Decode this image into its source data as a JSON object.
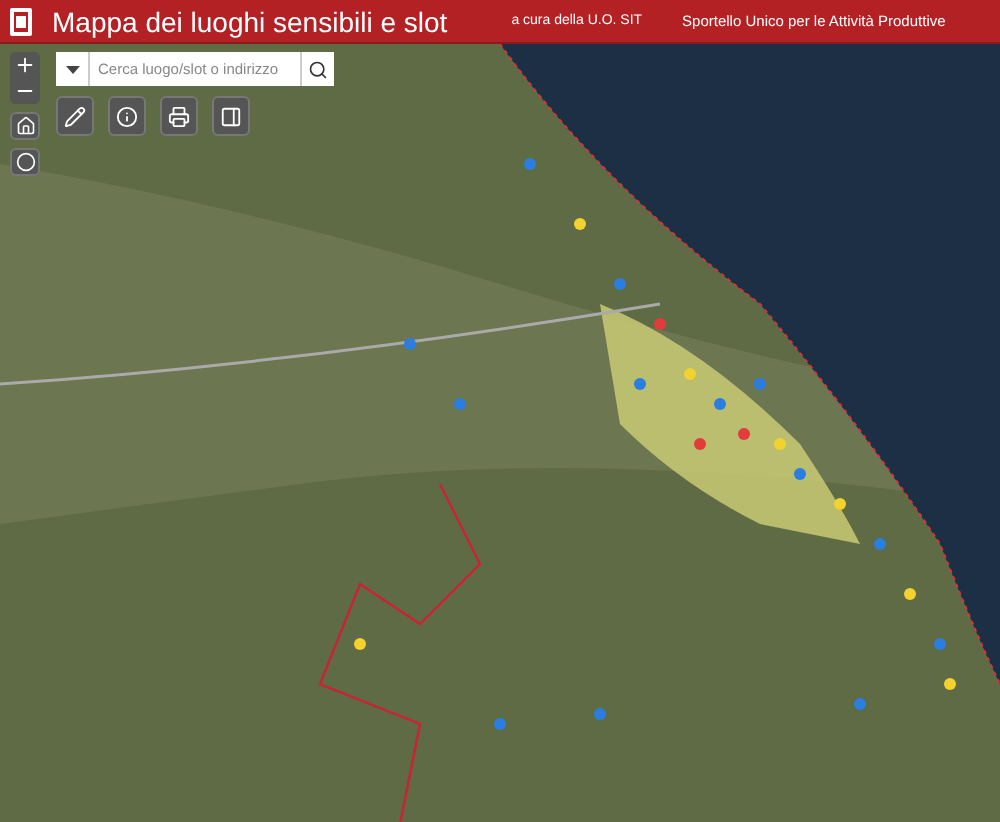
{
  "header": {
    "title": "Mappa dei luoghi sensibili e slot",
    "credit": "a cura della U.O. SIT",
    "office": "Sportello Unico per le Attività Produttive"
  },
  "search": {
    "placeholder": "Cerca luogo/slot o indirizzo"
  }
}
